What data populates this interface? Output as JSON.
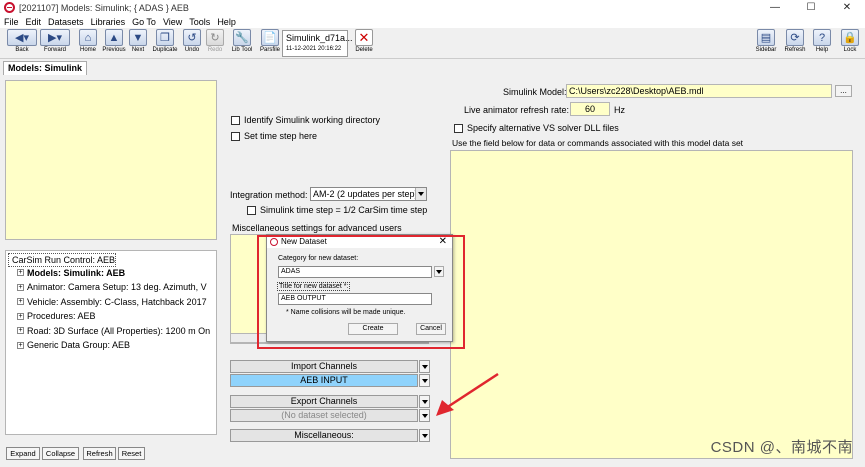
{
  "window": {
    "title": "[2021107] Models: Simulink; { ADAS } AEB",
    "controls": {
      "minimize": "—",
      "maximize": "☐",
      "close": "✕"
    }
  },
  "menu": [
    "File",
    "Edit",
    "Datasets",
    "Libraries",
    "Go To",
    "View",
    "Tools",
    "Help"
  ],
  "toolbar": {
    "back": "Back",
    "forward": "Forward",
    "home": "Home",
    "previous": "Previous",
    "next": "Next",
    "duplicate": "Duplicate",
    "undo": "Undo",
    "redo": "Redo",
    "lib_tool": "Lib Tool",
    "parsfile": "Parsfile",
    "dataset_name": "Simulink_d71a...",
    "dataset_time": "11-12-2021 20:16:22",
    "delete": "Delete",
    "sidebar": "Sidebar",
    "refresh": "Refresh",
    "help": "Help",
    "lock": "Lock"
  },
  "tab": "Models: Simulink",
  "tree": {
    "root": "CarSim Run Control: AEB",
    "children": [
      "Models: Simulink: AEB",
      "Animator: Camera Setup: 13 deg. Azimuth, V",
      "Vehicle: Assembly: C-Class, Hatchback 2017",
      "Procedures: AEB",
      "Road: 3D Surface (All Properties): 1200 m On",
      "Generic Data Group: AEB"
    ]
  },
  "bottom_buttons": {
    "expand": "Expand",
    "collapse": "Collapse",
    "refresh": "Refresh",
    "reset": "Reset"
  },
  "form": {
    "identify_wd": "Identify Simulink working directory",
    "set_time_step": "Set time step here",
    "integration_label": "Integration method:",
    "integration_value": "AM-2 (2 updates per step)",
    "sim_time_step": "Simulink time step = 1/2 CarSim time step",
    "misc_settings": "Miscellaneous settings for advanced users",
    "simulink_model_label": "Simulink Model:",
    "simulink_model_value": "C:\\Users\\zc228\\Desktop\\AEB.mdl",
    "browse": "...",
    "refresh_rate_label": "Live animator refresh rate:",
    "refresh_rate_value": "60",
    "refresh_rate_unit": "Hz",
    "alt_solver": "Specify alternative VS solver DLL files",
    "data_field_label": "Use the field below  for data or commands associated with this model data set"
  },
  "channels": {
    "import": "Import Channels",
    "import_value": "AEB INPUT",
    "export": "Export Channels",
    "export_value": "(No dataset selected)",
    "misc": "Miscellaneous:"
  },
  "dialog": {
    "title": "New Dataset",
    "close": "✕",
    "category_label": "Category for new dataset:",
    "category_value": "ADAS",
    "name_label": "Title for new dataset *:",
    "name_value": "AEB OUTPUT",
    "note": "* Name collisions will be made unique.",
    "create": "Create",
    "cancel": "Cancel"
  },
  "watermark": "CSDN @、南城不南"
}
